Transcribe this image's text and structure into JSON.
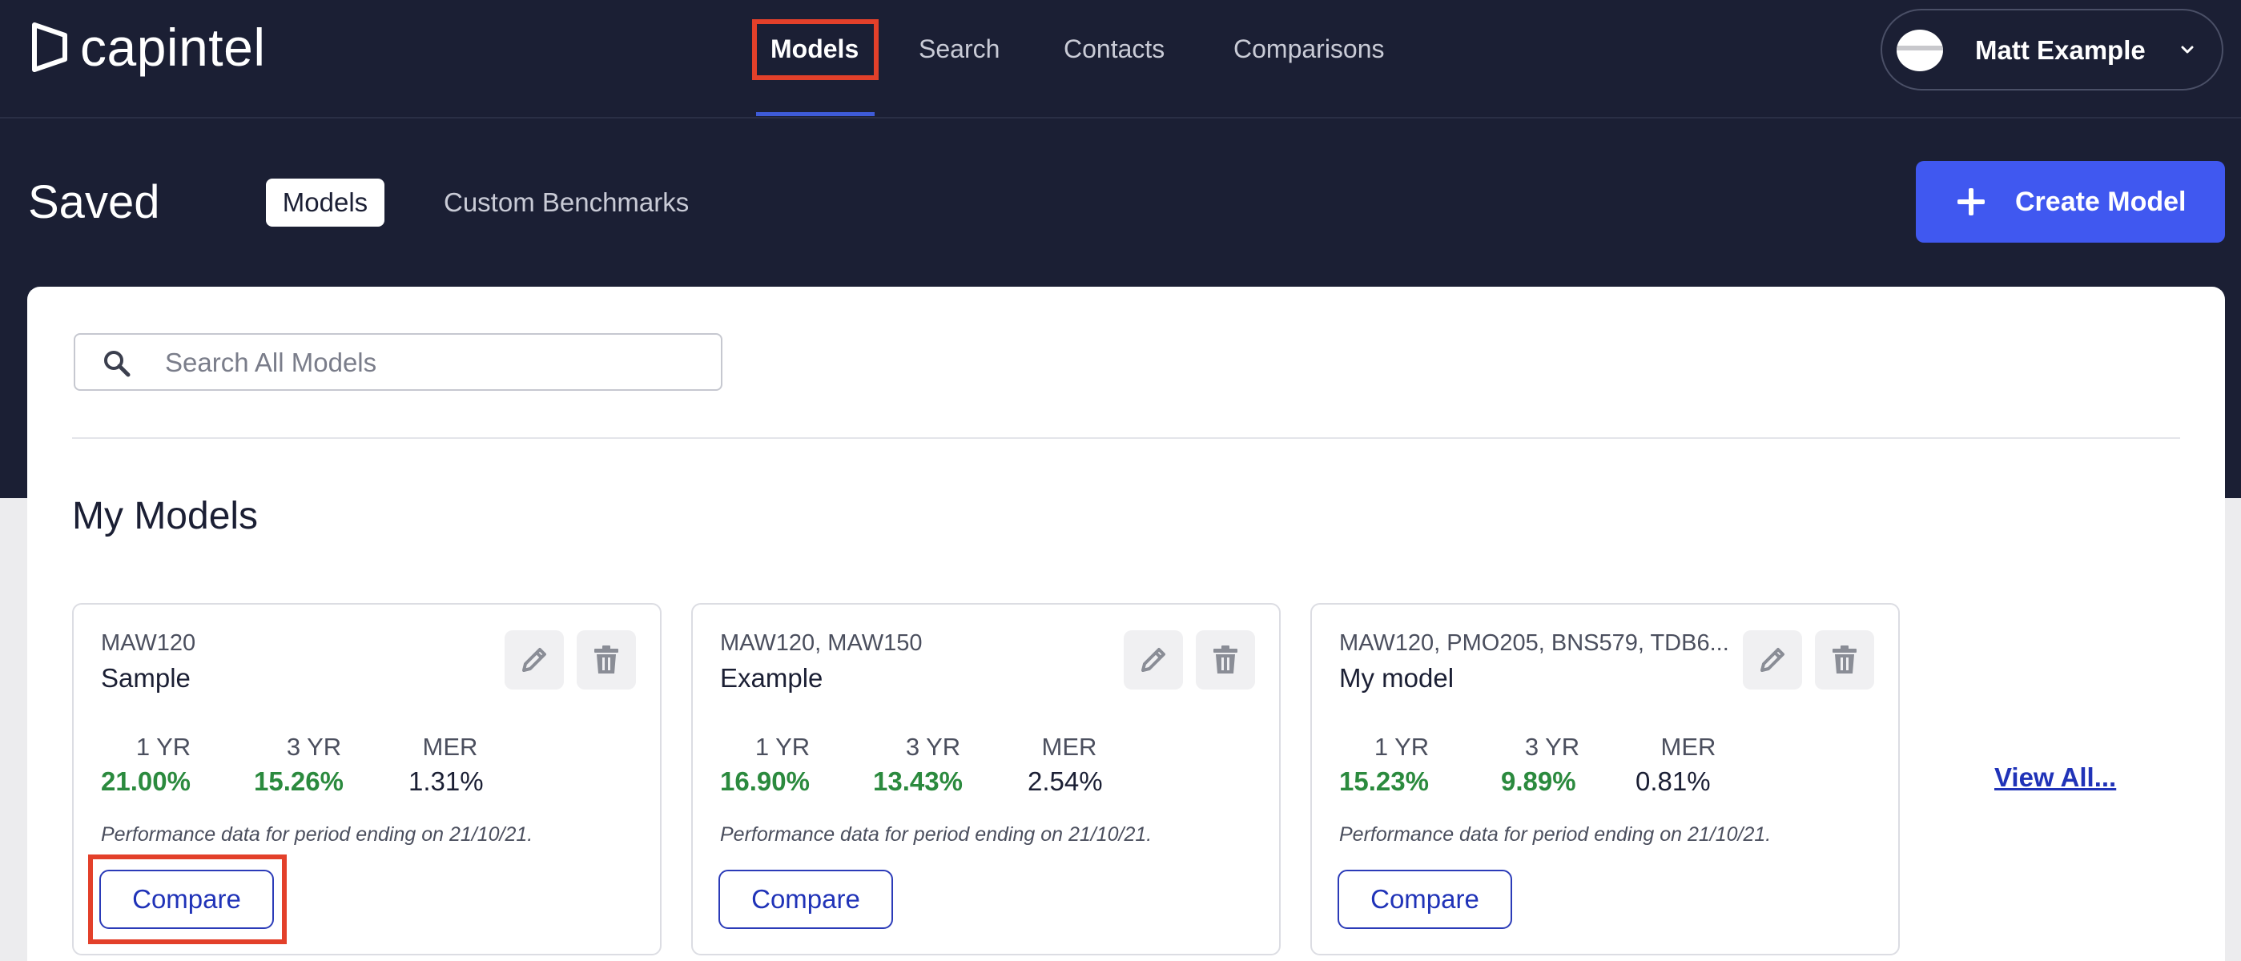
{
  "app": {
    "logo_text": "capintel"
  },
  "nav": {
    "items": [
      {
        "label": "Models",
        "active": true
      },
      {
        "label": "Search",
        "active": false
      },
      {
        "label": "Contacts",
        "active": false
      },
      {
        "label": "Comparisons",
        "active": false
      }
    ]
  },
  "user": {
    "name": "Matt Example"
  },
  "page": {
    "title": "Saved",
    "tabs": [
      {
        "label": "Models",
        "active": true
      },
      {
        "label": "Custom Benchmarks",
        "active": false
      }
    ],
    "create_button_label": "Create Model"
  },
  "search": {
    "placeholder": "Search All Models",
    "value": ""
  },
  "section": {
    "title": "My Models"
  },
  "cards": [
    {
      "tickers": "MAW120",
      "name": "Sample",
      "stats": [
        {
          "label": "1 YR",
          "value": "21.00%"
        },
        {
          "label": "3 YR",
          "value": "15.26%"
        },
        {
          "label": "MER",
          "value": "1.31%"
        }
      ],
      "note": "Performance data for period ending on 21/10/21.",
      "compare_label": "Compare"
    },
    {
      "tickers": "MAW120, MAW150",
      "name": "Example",
      "stats": [
        {
          "label": "1 YR",
          "value": "16.90%"
        },
        {
          "label": "3 YR",
          "value": "13.43%"
        },
        {
          "label": "MER",
          "value": "2.54%"
        }
      ],
      "note": "Performance data for period ending on 21/10/21.",
      "compare_label": "Compare"
    },
    {
      "tickers": "MAW120, PMO205, BNS579, TDB6...",
      "name": "My model",
      "stats": [
        {
          "label": "1 YR",
          "value": "15.23%"
        },
        {
          "label": "3 YR",
          "value": "9.89%"
        },
        {
          "label": "MER",
          "value": "0.81%"
        }
      ],
      "note": "Performance data for period ending on 21/10/21.",
      "compare_label": "Compare"
    }
  ],
  "view_all_label": "View All...",
  "colors": {
    "header_bg": "#1b1f34",
    "accent": "#4058f0",
    "positive": "#2b8a3e",
    "highlight": "#e3402a",
    "link": "#2033b8"
  }
}
